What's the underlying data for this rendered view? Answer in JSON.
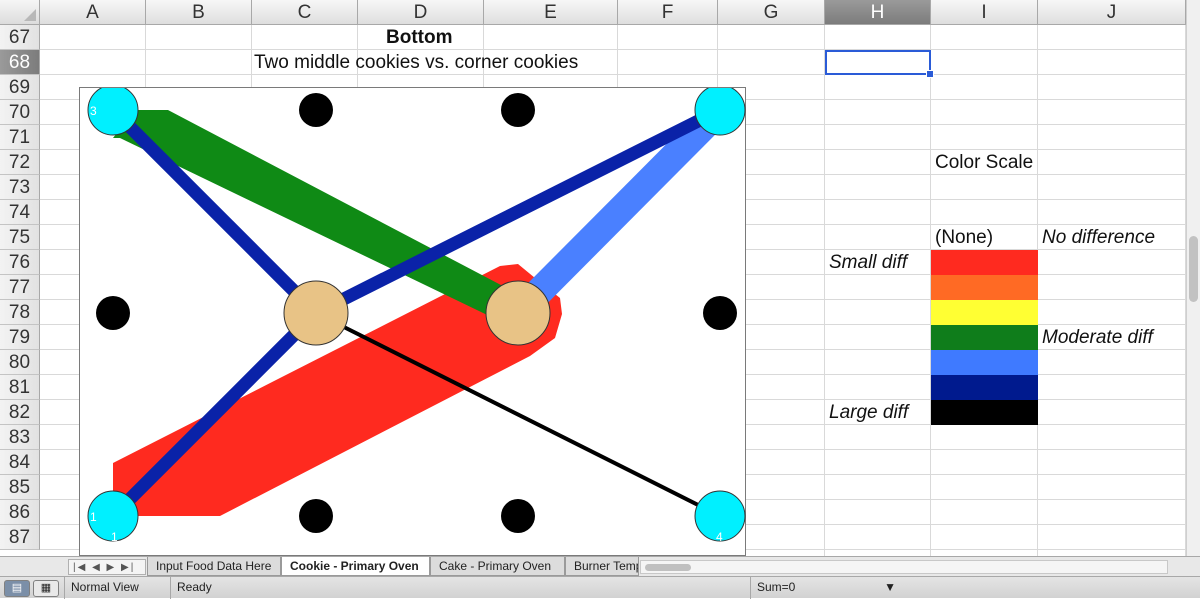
{
  "columns": [
    "A",
    "B",
    "C",
    "D",
    "E",
    "F",
    "G",
    "H",
    "I",
    "J"
  ],
  "rows": [
    "67",
    "68",
    "69",
    "70",
    "71",
    "72",
    "73",
    "74",
    "75",
    "76",
    "77",
    "78",
    "79",
    "80",
    "81",
    "82",
    "83",
    "84",
    "85",
    "86",
    "87"
  ],
  "selected_column": "H",
  "selected_row": "68",
  "cells": {
    "d67": "Bottom",
    "c68": "Two middle cookies vs. corner cookies",
    "color_scale_title": "Color Scale",
    "none_label": "(None)",
    "no_difference": "No difference",
    "small_diff": "Small diff",
    "moderate_diff": "Moderate diff",
    "large_diff": "Large diff"
  },
  "color_scale": [
    {
      "label": "Small diff",
      "color": "#ff2a1f"
    },
    {
      "label": "",
      "color": "#ff6a24"
    },
    {
      "label": "",
      "color": "#ffff33"
    },
    {
      "label": "Moderate diff",
      "color": "#0f7d1b"
    },
    {
      "label": "",
      "color": "#3f7aff"
    },
    {
      "label": "",
      "color": "#001a8e"
    },
    {
      "label": "Large diff",
      "color": "#000000"
    }
  ],
  "chart": {
    "corner_labels": {
      "top_left": "3",
      "bottom_left": "1",
      "bottom_left_2": "1",
      "bottom_right": "4"
    },
    "colors": {
      "corner_cookie": "#00f0ff",
      "middle_cookie": "#e8c386",
      "black_cookie": "#000000",
      "red": "#ff2a1f",
      "green": "#0f8a15",
      "light_blue": "#4a80ff",
      "dark_blue": "#0a22a8",
      "black_line": "#000000"
    }
  },
  "sheet_tabs": [
    {
      "label": "Input Food Data Here",
      "active": false
    },
    {
      "label": "Cookie - Primary Oven",
      "active": true
    },
    {
      "label": "Cake - Primary Oven",
      "active": false
    },
    {
      "label": "Burner Temp",
      "active": false
    }
  ],
  "status": {
    "view": "Normal View",
    "ready": "Ready",
    "sum": "Sum=0"
  }
}
